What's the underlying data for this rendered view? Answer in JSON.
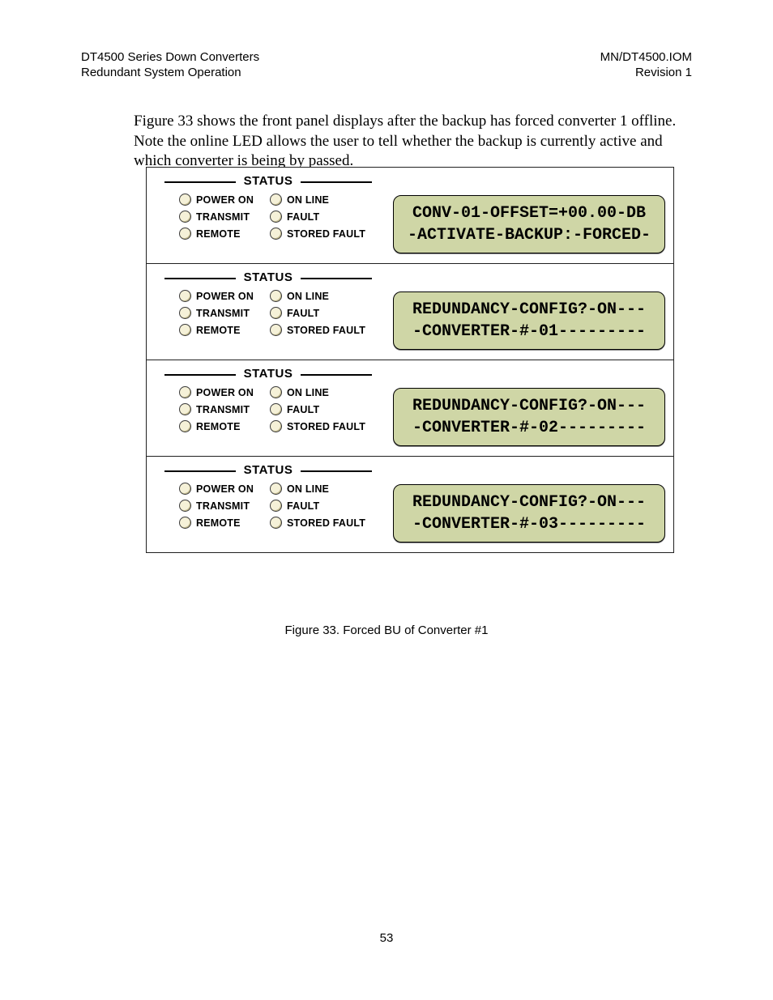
{
  "header": {
    "left_line1": "DT4500 Series Down Converters",
    "left_line2": "Redundant System Operation",
    "right_line1": "MN/DT4500.IOM",
    "right_line2": "Revision 1"
  },
  "paragraph": "Figure 33 shows the front panel displays after the backup has forced converter 1 offline. Note the online LED allows the user to tell whether the backup is currently active and which converter is being by passed.",
  "status_title": "STATUS",
  "led_labels": {
    "power_on": "POWER ON",
    "transmit": "TRANSMIT",
    "remote": "REMOTE",
    "on_line": "ON LINE",
    "fault": "FAULT",
    "stored_fault": "STORED FAULT"
  },
  "panels": [
    {
      "lcd_line1": "CONV-01-OFFSET=+00.00-DB",
      "lcd_line2": "-ACTIVATE-BACKUP:-FORCED-"
    },
    {
      "lcd_line1": "REDUNDANCY-CONFIG?-ON---",
      "lcd_line2": "-CONVERTER-#-01---------"
    },
    {
      "lcd_line1": "REDUNDANCY-CONFIG?-ON---",
      "lcd_line2": "-CONVERTER-#-02---------"
    },
    {
      "lcd_line1": "REDUNDANCY-CONFIG?-ON---",
      "lcd_line2": "-CONVERTER-#-03---------"
    }
  ],
  "figure_caption": "Figure 33.  Forced BU of Converter #1",
  "page_number": "53"
}
